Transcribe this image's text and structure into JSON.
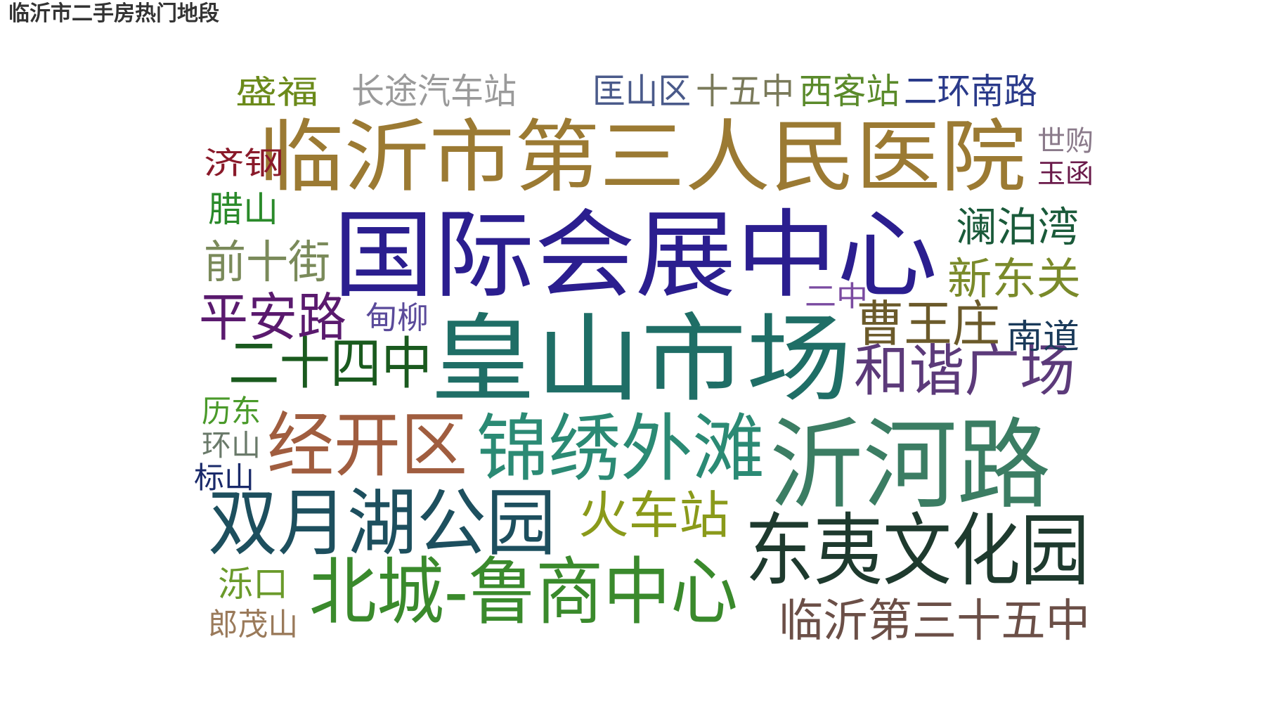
{
  "title": "临沂市二手房热门地段",
  "chart_data": {
    "type": "wordcloud",
    "title": "临沂市二手房热门地段",
    "words": [
      {
        "text": "临沂市第三人民医院",
        "color": "#9b7a33"
      },
      {
        "text": "国际会展中心",
        "color": "#2b1e8f"
      },
      {
        "text": "皇山市场",
        "color": "#1f6e66"
      },
      {
        "text": "沂河路",
        "color": "#3b7d63"
      },
      {
        "text": "东夷文化园",
        "color": "#1e3a2e"
      },
      {
        "text": "北城-鲁商中心",
        "color": "#3a8a2c"
      },
      {
        "text": "双月湖公园",
        "color": "#1d4f5e"
      },
      {
        "text": "锦绣外滩",
        "color": "#2b8a74"
      },
      {
        "text": "经开区",
        "color": "#a05d3f"
      },
      {
        "text": "和谐广场",
        "color": "#5c3a7a"
      },
      {
        "text": "二十四中",
        "color": "#1a5a1e"
      },
      {
        "text": "临沂第三十五中",
        "color": "#6b4f47"
      },
      {
        "text": "曹王庄",
        "color": "#6b5a2a"
      },
      {
        "text": "火车站",
        "color": "#8a9a1a"
      },
      {
        "text": "平安路",
        "color": "#5a1a6e"
      },
      {
        "text": "新东关",
        "color": "#7a8a2a"
      },
      {
        "text": "前十街",
        "color": "#7a8a5a"
      },
      {
        "text": "澜泊湾",
        "color": "#1a5a3a"
      },
      {
        "text": "长途汽车站",
        "color": "#9a9a9a"
      },
      {
        "text": "二环南路",
        "color": "#2a3a8a"
      },
      {
        "text": "匡山区",
        "color": "#4a5a8a"
      },
      {
        "text": "十五中",
        "color": "#7a7a5a"
      },
      {
        "text": "西客站",
        "color": "#5a8a2a"
      },
      {
        "text": "盛福",
        "color": "#6b8a1a"
      },
      {
        "text": "腊山",
        "color": "#2a8a2a"
      },
      {
        "text": "南道",
        "color": "#1a3a5a"
      },
      {
        "text": "甸柳",
        "color": "#5a4a9a"
      },
      {
        "text": "二中",
        "color": "#7a4aa0"
      },
      {
        "text": "济钢",
        "color": "#8a1a2a"
      },
      {
        "text": "世购",
        "color": "#8a7a8a"
      },
      {
        "text": "玉函",
        "color": "#6a1a4a"
      },
      {
        "text": "历东",
        "color": "#4a9a2a"
      },
      {
        "text": "环山",
        "color": "#6a7a6a"
      },
      {
        "text": "标山",
        "color": "#1a2a6a"
      },
      {
        "text": "泺口",
        "color": "#6a9a2a"
      },
      {
        "text": "郎茂山",
        "color": "#9a7a5a"
      }
    ]
  }
}
